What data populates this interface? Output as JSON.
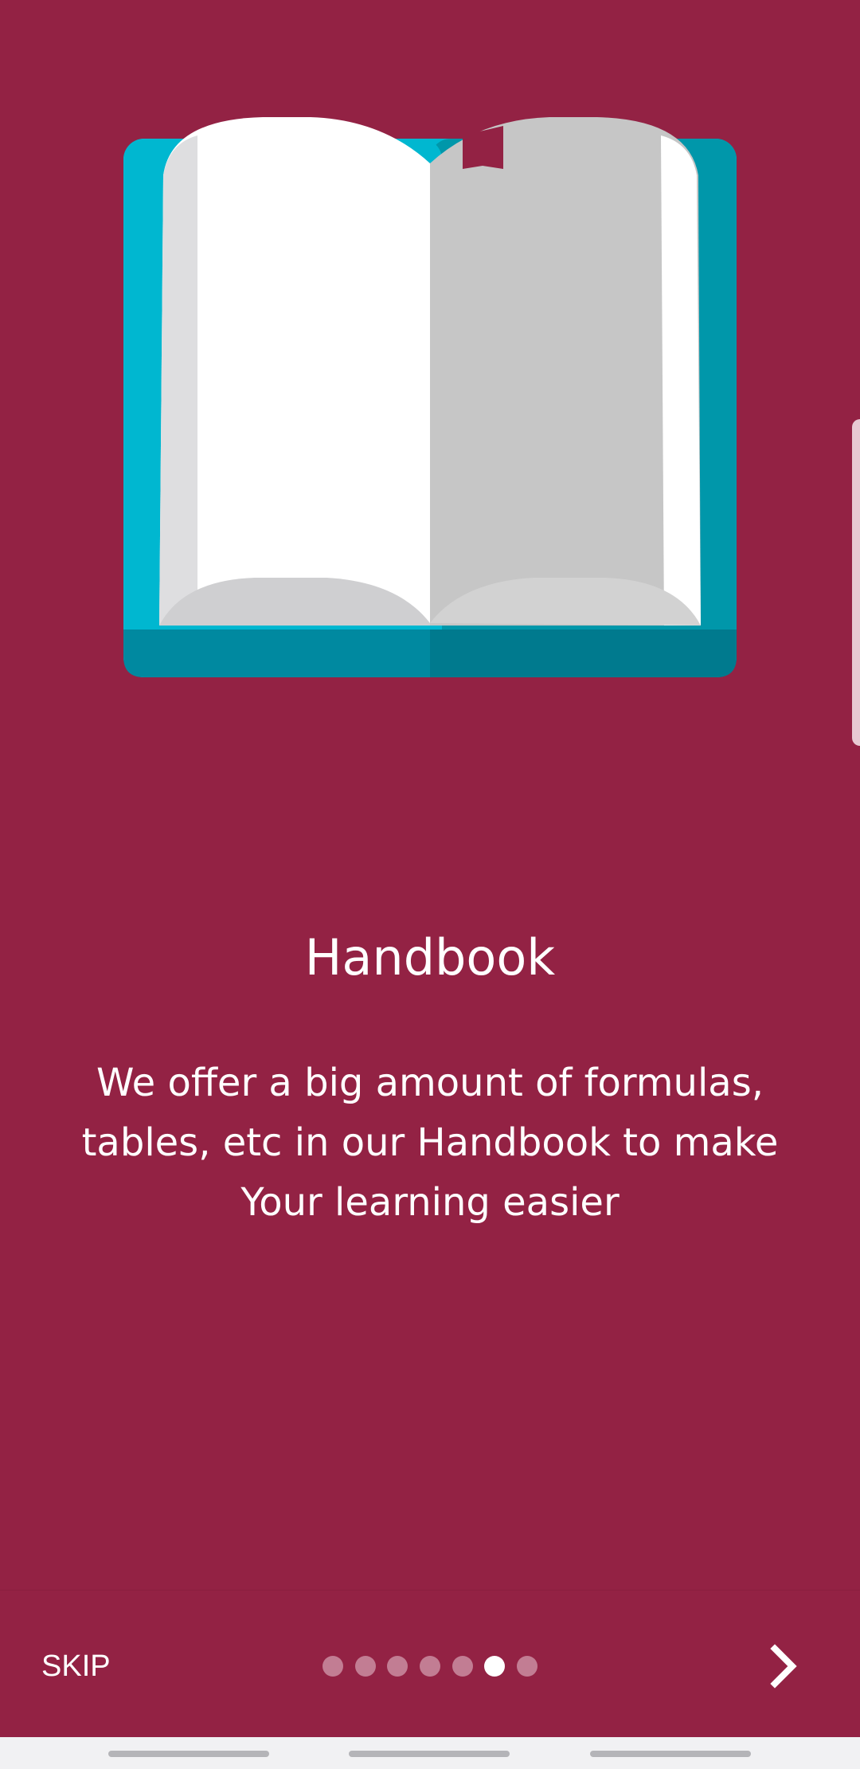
{
  "onboarding": {
    "title": "Handbook",
    "description": "We offer a big amount of formulas, tables, etc in our Handbook to make Your learning easier",
    "skip_label": "SKIP",
    "page_count": 7,
    "current_page": 6
  },
  "icons": {
    "illustration": "open-book-illustration",
    "next": "chevron-right-icon"
  },
  "colors": {
    "background": "#932244",
    "book_cover": "#00B7D0",
    "book_cover_dark": "#0097AA",
    "page_white": "#FFFFFF",
    "page_gray": "#C6C6C6",
    "bookmark": "#932244",
    "dot_active": "#FFFFFF",
    "dot_inactive": "#C27D93"
  }
}
